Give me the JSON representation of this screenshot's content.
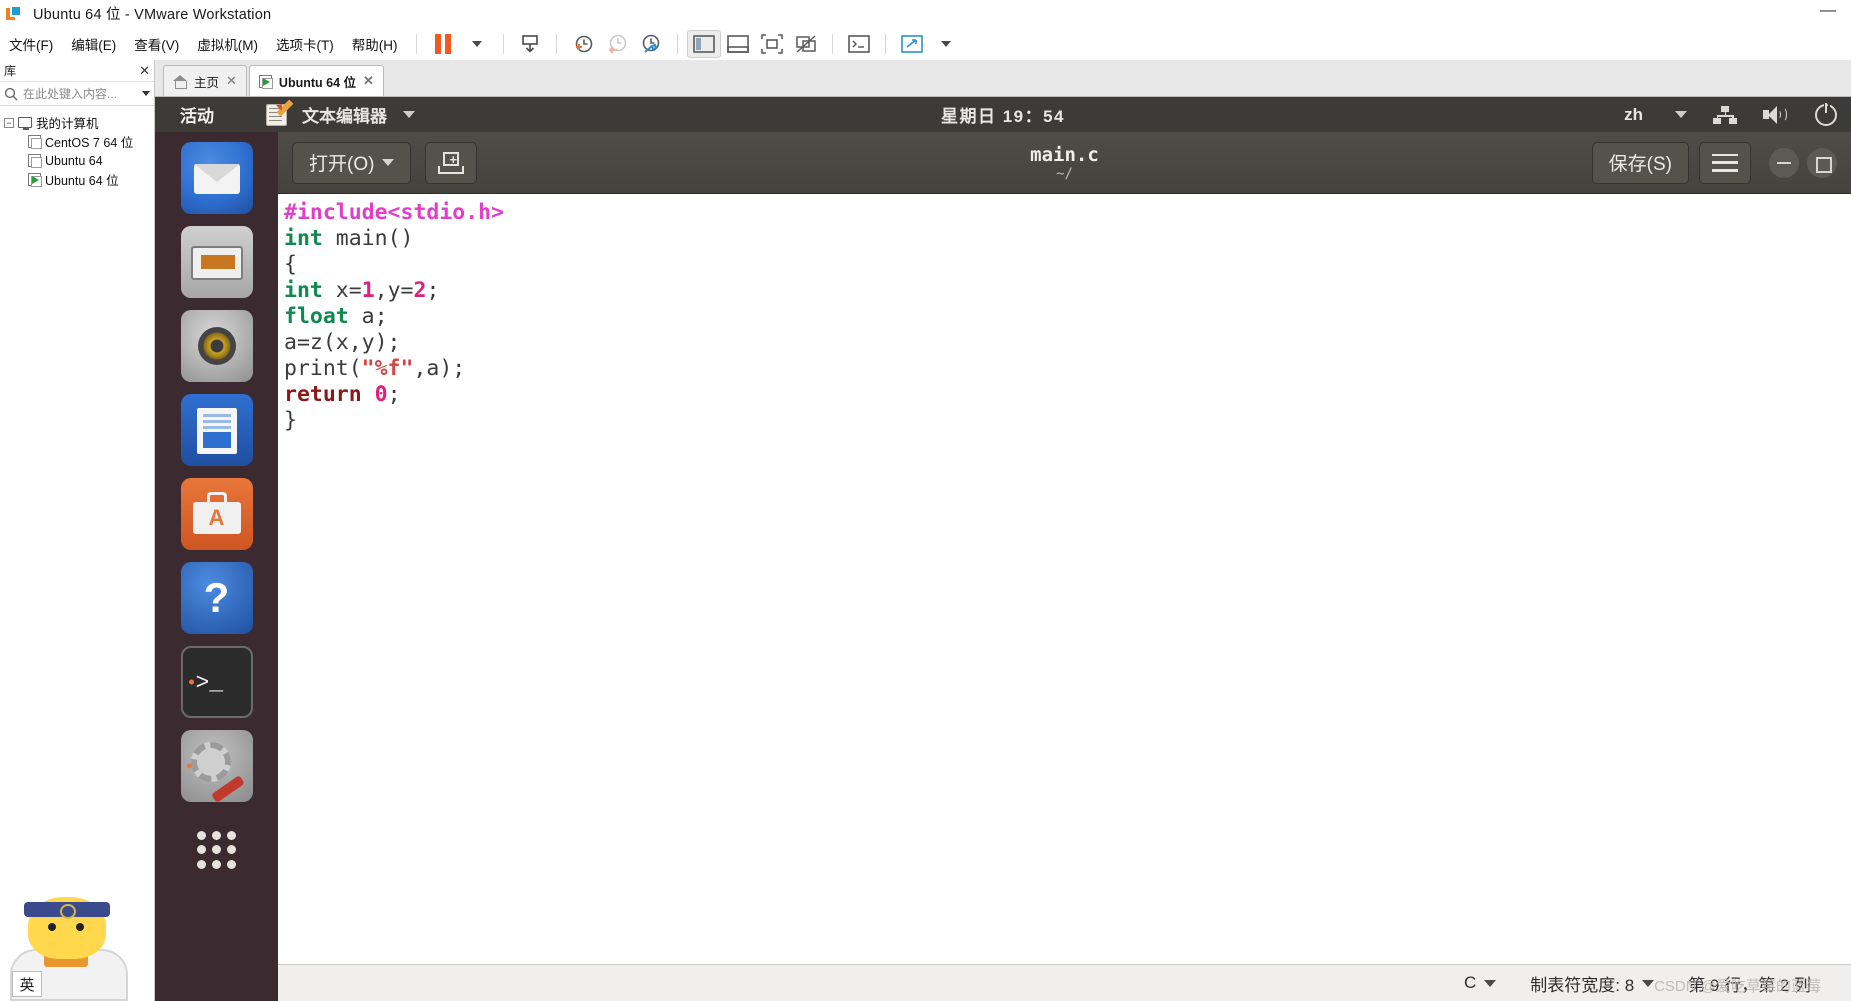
{
  "window": {
    "title": "Ubuntu 64 位 - VMware Workstation",
    "minimize_label": "—"
  },
  "menubar": {
    "items": [
      {
        "label": "文件(F)"
      },
      {
        "label": "编辑(E)"
      },
      {
        "label": "查看(V)"
      },
      {
        "label": "虚拟机(M)"
      },
      {
        "label": "选项卡(T)"
      },
      {
        "label": "帮助(H)"
      }
    ],
    "toolbar_icons": [
      {
        "name": "pause-vm",
        "glyph": "❚❚"
      },
      {
        "name": "pause-dropdown",
        "glyph": "▾"
      },
      {
        "name": "send-ctrl-alt-del",
        "glyph": "⎘"
      },
      {
        "name": "take-snapshot",
        "glyph": "🕘"
      },
      {
        "name": "revert-snapshot",
        "glyph": "🕘"
      },
      {
        "name": "manage-snapshots",
        "glyph": "🕘"
      },
      {
        "name": "show-library",
        "glyph": "▥"
      },
      {
        "name": "show-thumbnail-bar",
        "glyph": "▤"
      },
      {
        "name": "enter-fullscreen",
        "glyph": "⛶"
      },
      {
        "name": "unity-mode",
        "glyph": "⧉"
      },
      {
        "name": "console-view",
        "glyph": ">_"
      },
      {
        "name": "stretch-guest",
        "glyph": "⤢"
      },
      {
        "name": "stretch-dropdown",
        "glyph": "▾"
      }
    ]
  },
  "library": {
    "header_title": "库",
    "close_label": "✕",
    "search_placeholder": "在此处键入内容...",
    "tree": [
      {
        "label": "我的计算机",
        "level": 0,
        "icon": "monitor-icon",
        "running": false
      },
      {
        "label": "CentOS 7 64 位",
        "level": 1,
        "icon": "vm-icon",
        "running": false
      },
      {
        "label": "Ubuntu 64",
        "level": 1,
        "icon": "vm-icon",
        "running": false
      },
      {
        "label": "Ubuntu 64 位",
        "level": 1,
        "icon": "vm-running-icon",
        "running": true
      }
    ]
  },
  "tabs": [
    {
      "label": "主页",
      "icon": "home-icon",
      "active": false,
      "close": "✕"
    },
    {
      "label": "Ubuntu 64 位",
      "icon": "vm-running-icon",
      "active": true,
      "close": "✕"
    }
  ],
  "guest": {
    "topbar": {
      "activities": "活动",
      "app_name": "文本编辑器",
      "app_menu_caret": "▾",
      "clock": "星期日 19：54",
      "keyboard_layout": "zh",
      "keyboard_caret": "▾",
      "icons": [
        "network-icon",
        "volume-icon",
        "power-icon"
      ]
    },
    "dock": [
      {
        "name": "files-icon",
        "label": "文件",
        "running": false
      },
      {
        "name": "software-updater-icon",
        "label": "软件",
        "running": false
      },
      {
        "name": "rhythmbox-icon",
        "label": "Rhythmbox",
        "running": false
      },
      {
        "name": "libreoffice-writer-icon",
        "label": "LibreOffice Writer",
        "running": false
      },
      {
        "name": "ubuntu-software-icon",
        "label": "Ubuntu 软件",
        "running": false
      },
      {
        "name": "help-icon",
        "label": "帮助",
        "running": false
      },
      {
        "name": "terminal-icon",
        "label": "终端",
        "running": true
      },
      {
        "name": "settings-icon",
        "label": "设置",
        "running": true
      },
      {
        "name": "show-applications-icon",
        "label": "显示应用程序",
        "running": false
      }
    ],
    "gedit": {
      "open_button": "打开(O)",
      "open_caret": "▾",
      "new_doc_icon": "new-document-icon",
      "filename": "main.c",
      "filepath": "~/",
      "save_button": "保存(S)",
      "menu_icon": "hamburger-menu-icon",
      "window_controls": [
        "minimize-icon",
        "maximize-icon"
      ],
      "code_lines": [
        [
          {
            "t": "#include<stdio.h>",
            "c": "k-pre"
          }
        ],
        [
          {
            "t": "int",
            "c": "k-type"
          },
          {
            "t": " main()",
            "c": "k-plain"
          }
        ],
        [
          {
            "t": "{",
            "c": "k-plain"
          }
        ],
        [
          {
            "t": "int",
            "c": "k-type"
          },
          {
            "t": " x=",
            "c": "k-plain"
          },
          {
            "t": "1",
            "c": "k-num"
          },
          {
            "t": ",y=",
            "c": "k-plain"
          },
          {
            "t": "2",
            "c": "k-num"
          },
          {
            "t": ";",
            "c": "k-plain"
          }
        ],
        [
          {
            "t": "float",
            "c": "k-type"
          },
          {
            "t": " a;",
            "c": "k-plain"
          }
        ],
        [
          {
            "t": "a=z(x,y);",
            "c": "k-plain"
          }
        ],
        [
          {
            "t": "print(",
            "c": "k-plain"
          },
          {
            "t": "\"%f\"",
            "c": "k-str"
          },
          {
            "t": ",a);",
            "c": "k-plain"
          }
        ],
        [
          {
            "t": "return",
            "c": "k-ret"
          },
          {
            "t": " ",
            "c": "k-plain"
          },
          {
            "t": "0",
            "c": "k-num"
          },
          {
            "t": ";",
            "c": "k-plain"
          }
        ],
        [
          {
            "t": "}",
            "c": "k-plain"
          }
        ]
      ],
      "statusbar": {
        "language": "C",
        "language_caret": "▾",
        "tab_width": "制表符宽度: 8",
        "tab_caret": "▾",
        "cursor_position": "第 9 行，第 2 列"
      }
    }
  },
  "watermark": "CSDN @爱吃草莓的蓝莓",
  "ime": {
    "mode_label": "英"
  },
  "colors": {
    "accent_orange": "#f05a22",
    "gnome_bar": "#3c3b37",
    "dock_bg": "#3b2b30",
    "gedit_header": "#504d48"
  }
}
